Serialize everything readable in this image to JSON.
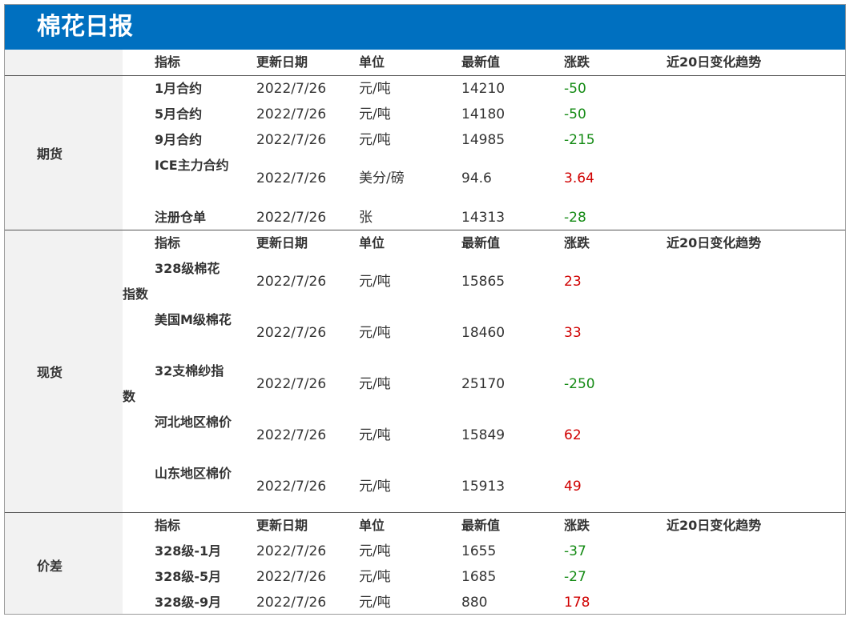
{
  "title": "棉花日报",
  "headers": [
    "指标",
    "更新日期",
    "单位",
    "最新值",
    "涨跌",
    "近20日变化趋势"
  ],
  "sections": [
    {
      "category": "期货",
      "rows": [
        {
          "name": "1月合约",
          "date": "2022/7/26",
          "unit": "元/吨",
          "value": "14210",
          "change": "-50",
          "dir": "neg"
        },
        {
          "name": "5月合约",
          "date": "2022/7/26",
          "unit": "元/吨",
          "value": "14180",
          "change": "-50",
          "dir": "neg"
        },
        {
          "name": "9月合约",
          "date": "2022/7/26",
          "unit": "元/吨",
          "value": "14985",
          "change": "-215",
          "dir": "neg"
        },
        {
          "name": "ICE主力合约",
          "date": "2022/7/26",
          "unit": "美分/磅",
          "value": "94.6",
          "change": "3.64",
          "dir": "pos"
        },
        {
          "name": "注册仓单",
          "date": "2022/7/26",
          "unit": "张",
          "value": "14313",
          "change": "-28",
          "dir": "neg"
        }
      ]
    },
    {
      "category": "现货",
      "rows": [
        {
          "name": "328级棉花指数",
          "date": "2022/7/26",
          "unit": "元/吨",
          "value": "15865",
          "change": "23",
          "dir": "pos"
        },
        {
          "name": "美国M级棉花",
          "date": "2022/7/26",
          "unit": "元/吨",
          "value": "18460",
          "change": "33",
          "dir": "pos"
        },
        {
          "name": "32支棉纱指数",
          "date": "2022/7/26",
          "unit": "元/吨",
          "value": "25170",
          "change": "-250",
          "dir": "neg"
        },
        {
          "name": "河北地区棉价",
          "date": "2022/7/26",
          "unit": "元/吨",
          "value": "15849",
          "change": "62",
          "dir": "pos"
        },
        {
          "name": "山东地区棉价",
          "date": "2022/7/26",
          "unit": "元/吨",
          "value": "15913",
          "change": "49",
          "dir": "pos"
        }
      ]
    },
    {
      "category": "价差",
      "rows": [
        {
          "name": "328级-1月",
          "date": "2022/7/26",
          "unit": "元/吨",
          "value": "1655",
          "change": "-37",
          "dir": "neg"
        },
        {
          "name": "328级-5月",
          "date": "2022/7/26",
          "unit": "元/吨",
          "value": "1685",
          "change": "-27",
          "dir": "neg"
        },
        {
          "name": "328级-9月",
          "date": "2022/7/26",
          "unit": "元/吨",
          "value": "880",
          "change": "178",
          "dir": "pos"
        }
      ]
    }
  ]
}
